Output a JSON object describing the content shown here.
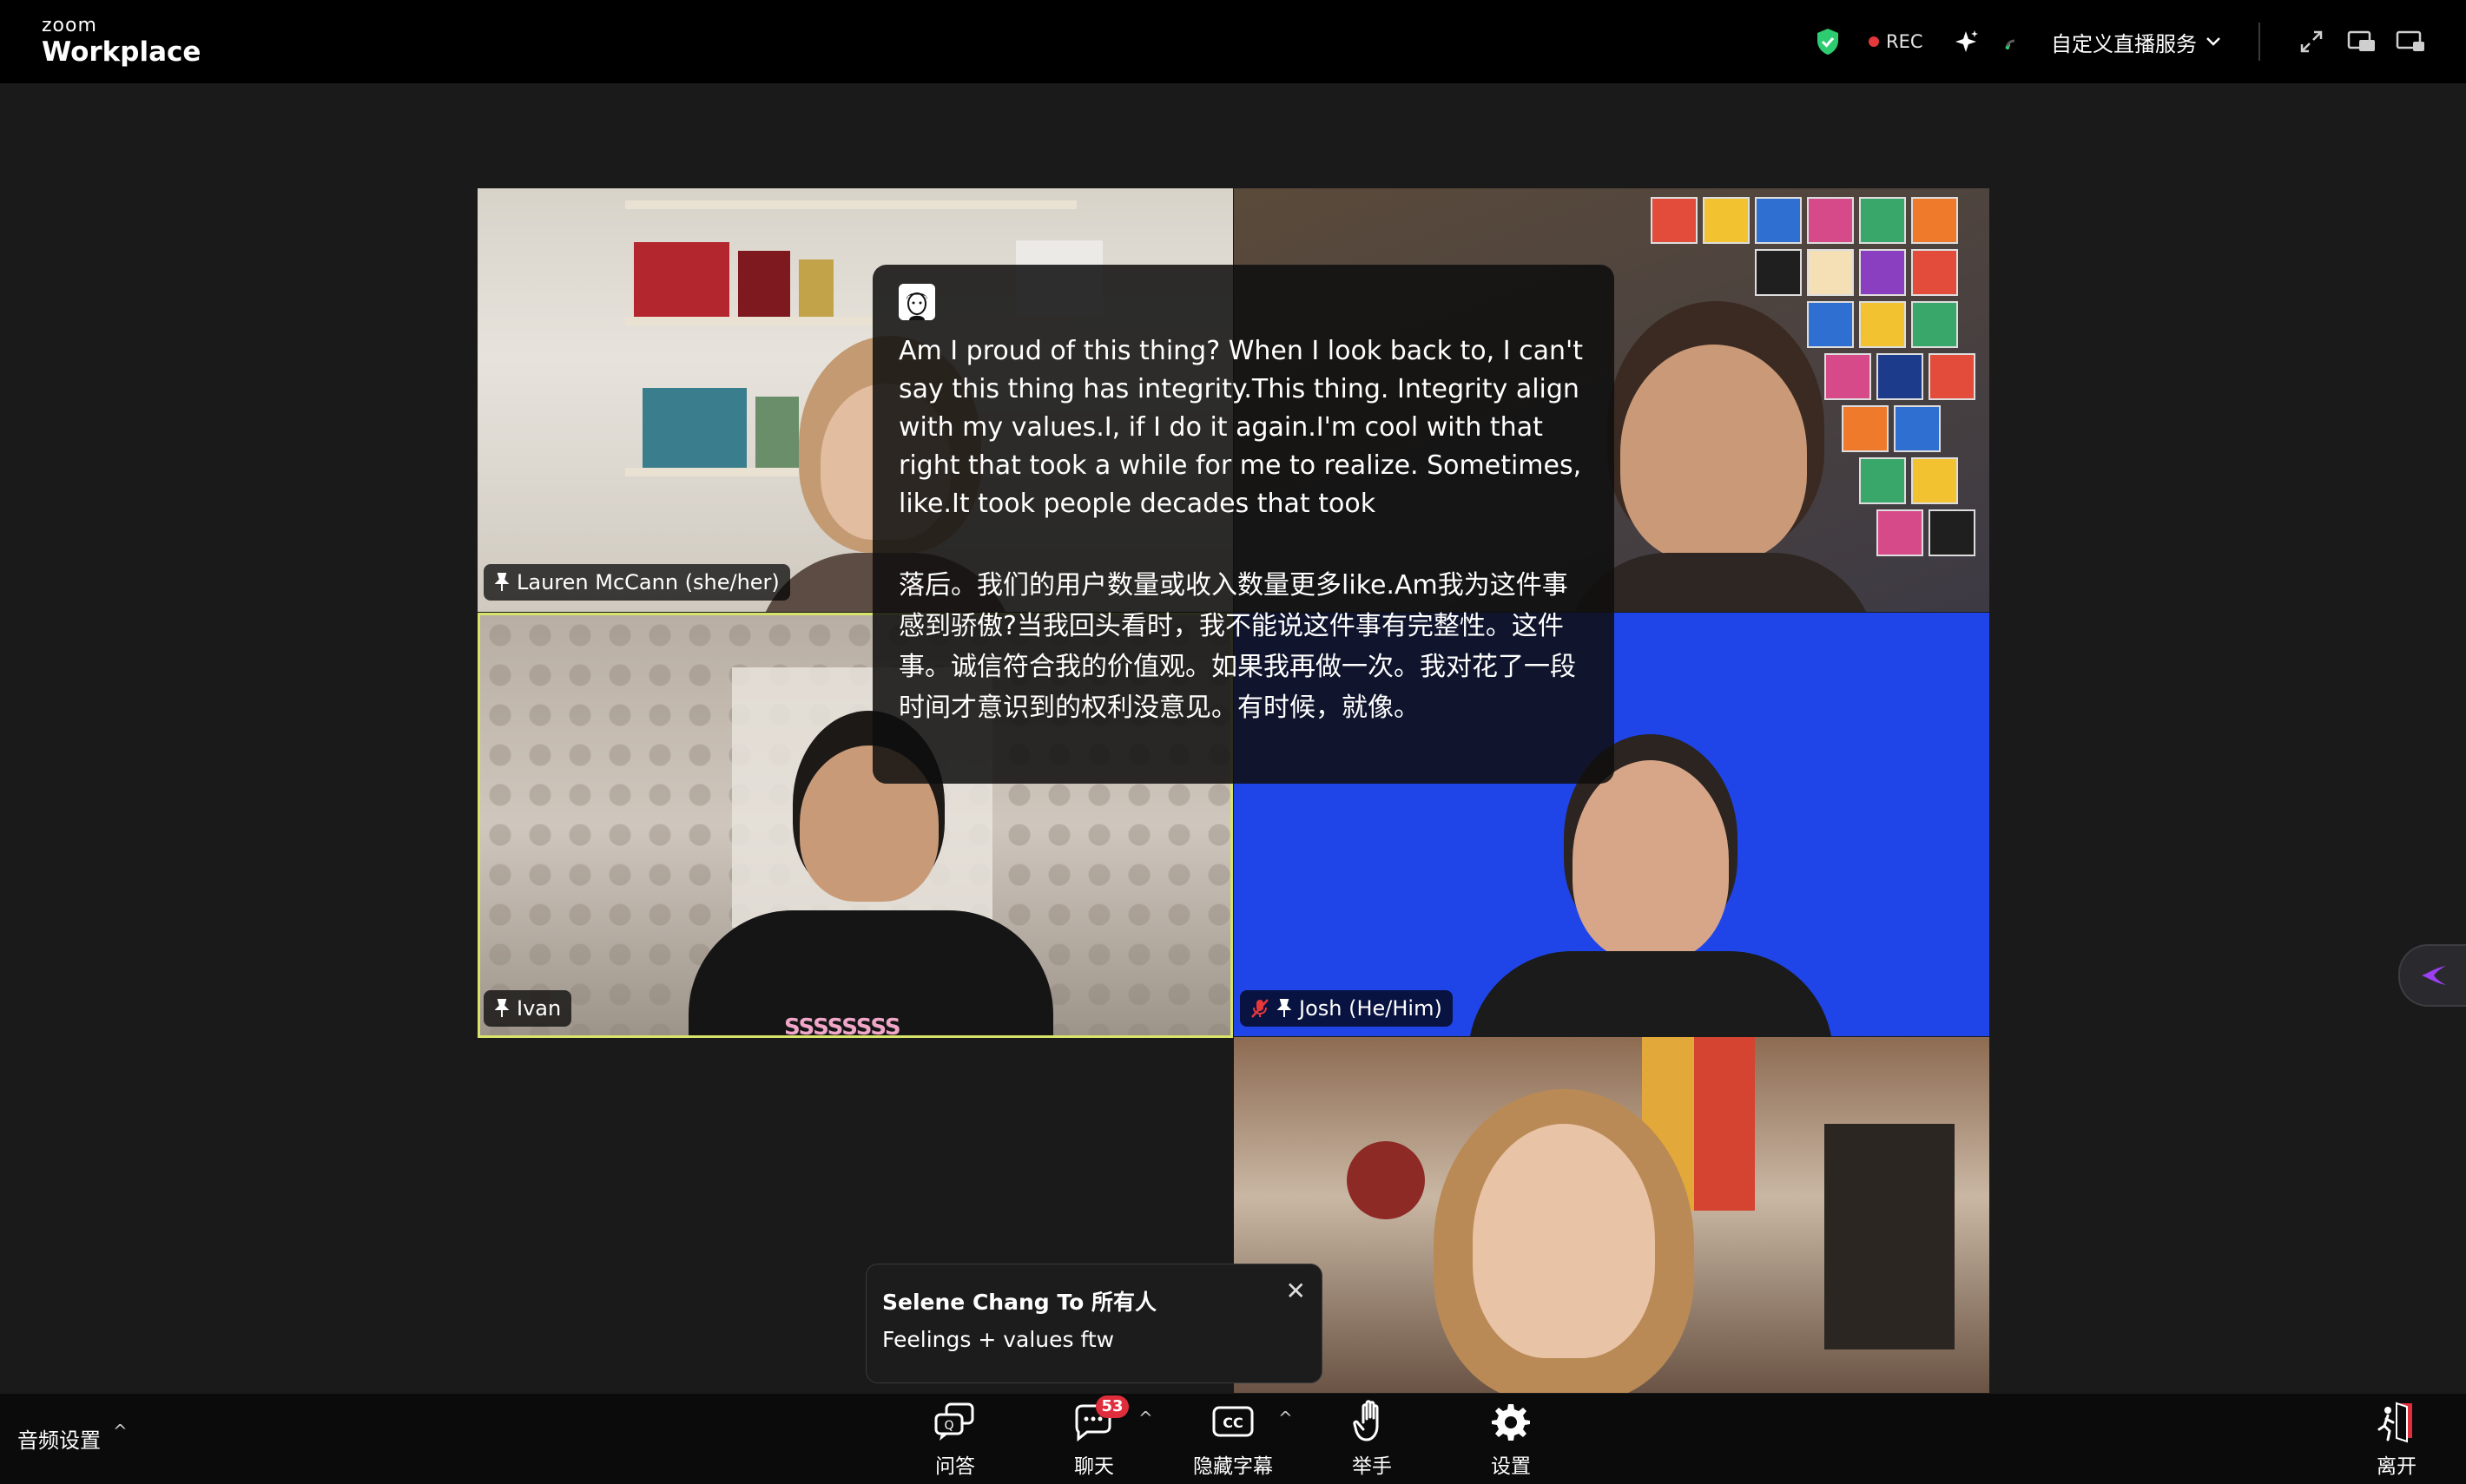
{
  "app": {
    "brand_small": "zoom",
    "brand_name": "Workplace"
  },
  "topbar": {
    "rec_label": "REC",
    "live_menu_label": "自定义直播服务"
  },
  "participants": [
    {
      "name": "Lauren McCann (she/her)"
    },
    {
      "name": "Ivan"
    },
    {
      "name": "Josh (He/Him)",
      "muted": true
    }
  ],
  "caption": {
    "english": "Am I proud of this thing? When I look back to, I can't say this thing has integrity.This thing. Integrity align with my values.I, if I do it again.I'm cool with that right that took a while for me to realize. Sometimes, like.It took people decades that took",
    "chinese": "落后。我们的用户数量或收入数量更多like.Am我为这件事感到骄傲?当我回头看时，我不能说这件事有完整性。这件事。诚信符合我的价值观。如果我再做一次。我对花了一段时间才意识到的权利没意见。有时候，就像。"
  },
  "chat_toast": {
    "from": "Selene Chang To 所有人",
    "message": "Feelings + values ftw"
  },
  "toolbar": {
    "audio_settings": "音频设置",
    "qa": "问答",
    "chat": "聊天",
    "chat_badge": "53",
    "captions": "隐藏字幕",
    "raise_hand": "举手",
    "settings": "设置",
    "leave": "离开"
  },
  "colors": {
    "accent_active_border": "#d8e36a",
    "rec_dot": "#e5383b",
    "badge": "#e02d3c",
    "shield": "#2ecc71",
    "josh_bg": "#1f45e8"
  }
}
